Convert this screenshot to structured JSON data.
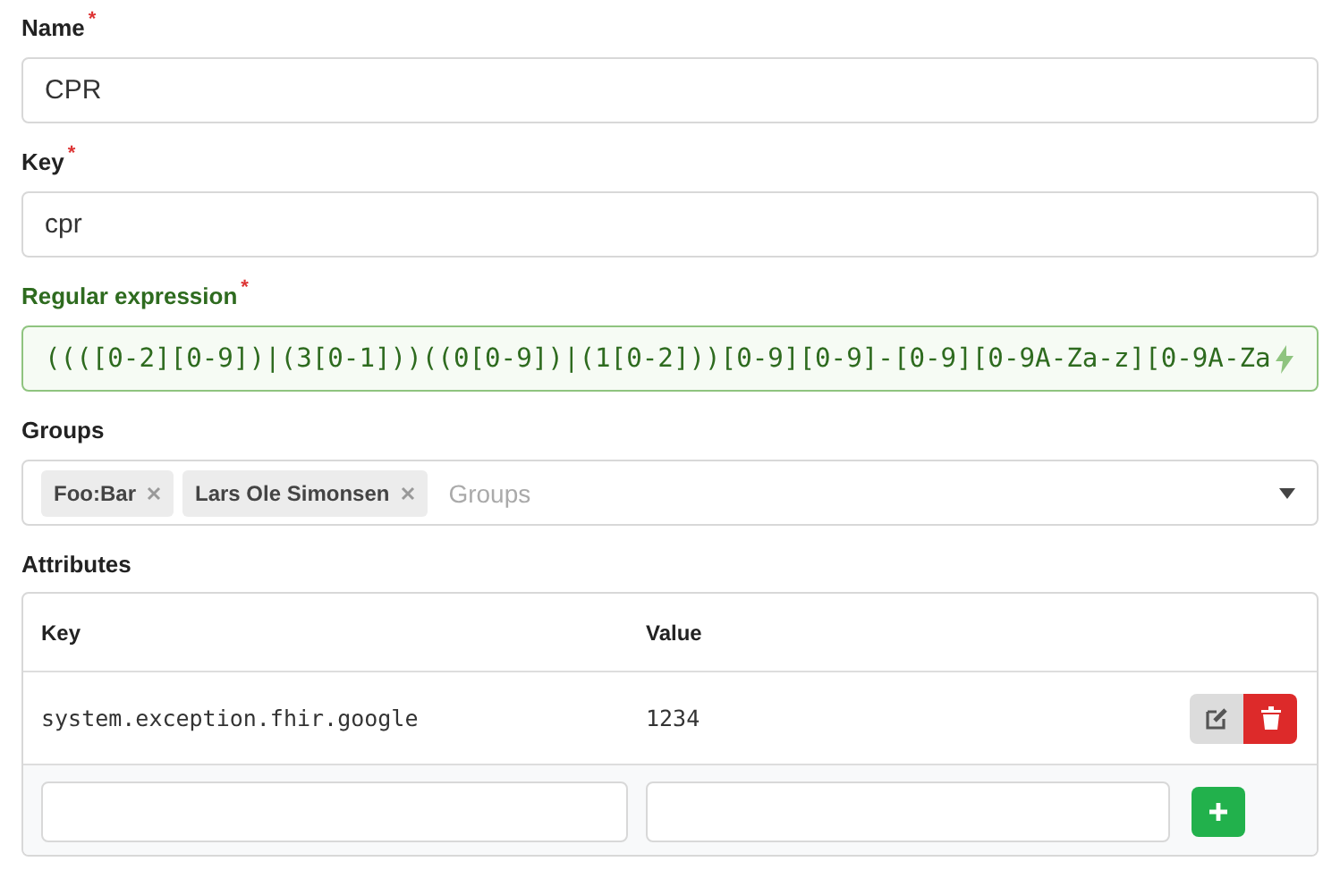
{
  "fields": [
    {
      "label": "Name",
      "required_mark": "*",
      "value": "CPR",
      "kind": "text",
      "valid": false
    },
    {
      "label": "Key",
      "required_mark": "*",
      "value": "cpr",
      "kind": "text",
      "valid": false
    },
    {
      "label": "Regular expression",
      "required_mark": "*",
      "value": "((([0-2][0-9])|(3[0-1]))((0[0-9])|(1[0-2]))[0-9][0-9]-[0-9][0-9A-Za-z][0-9A-Za",
      "kind": "regex",
      "valid": true
    }
  ],
  "groups": {
    "label": "Groups",
    "tags": [
      "Foo:Bar",
      "Lars Ole Simonsen"
    ],
    "placeholder": "Groups"
  },
  "attributes": {
    "label": "Attributes",
    "columns": [
      "Key",
      "Value"
    ],
    "rows": [
      {
        "key": "system.exception.fhir.google",
        "value": "1234"
      }
    ]
  }
}
